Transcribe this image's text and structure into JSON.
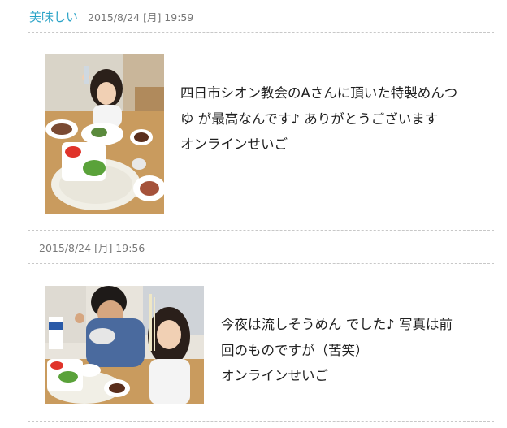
{
  "post1": {
    "title": "美味しい",
    "date": "2015/8/24 [月] 19:59",
    "text_lines": [
      "四日市シオン教会のAさんに頂いた特製めんつ",
      "ゆ が最高なんです♪ ありがとうございます",
      "オンラインせいご"
    ],
    "photo_desc": "girl-with-somen-machine-photo"
  },
  "post2": {
    "date": "2015/8/24 [月] 19:56",
    "text_lines": [
      "今夜は流しそうめん でした♪ 写真は前",
      "回のものですが（苦笑）",
      "オンラインせいご"
    ],
    "photo_desc": "man-and-girl-eating-somen-photo"
  },
  "colors": {
    "title_link": "#2aa3c7",
    "date": "#777777",
    "divider": "#c8c8c8"
  }
}
